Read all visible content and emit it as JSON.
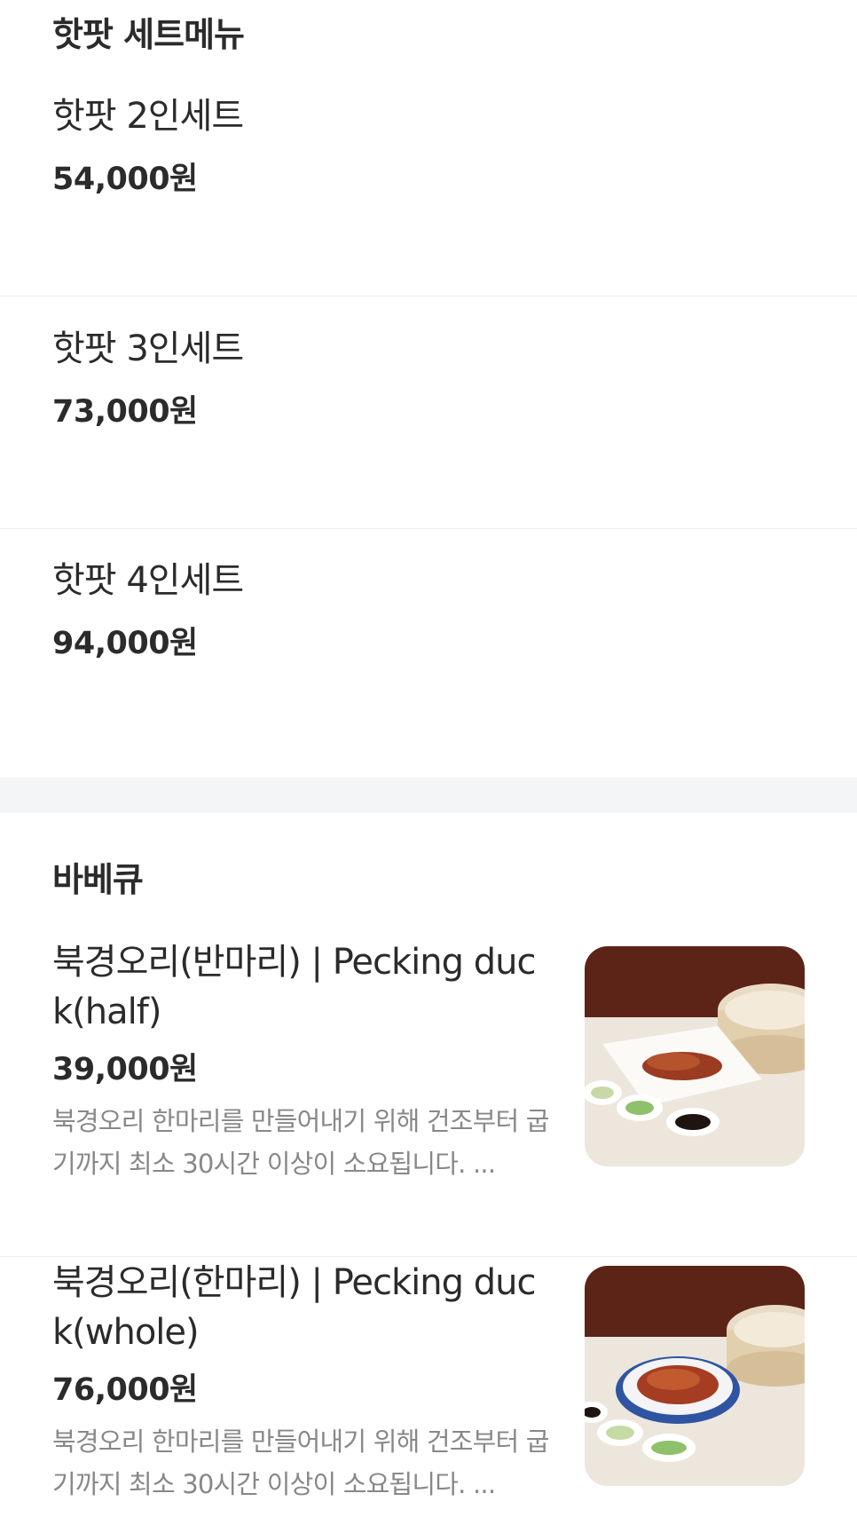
{
  "set_menu": {
    "title": "핫팟 세트메뉴",
    "items": [
      {
        "name": "핫팟 2인세트",
        "price": "54,000원"
      },
      {
        "name": "핫팟 3인세트",
        "price": "73,000원"
      },
      {
        "name": "핫팟 4인세트",
        "price": "94,000원"
      }
    ]
  },
  "bbq": {
    "title": "바베큐",
    "items": [
      {
        "name": "북경오리(반마리) | Pecking duck(half)",
        "price": "39,000원",
        "description": "북경오리 한마리를 만들어내기 위해 건조부터 굽기까지 최소 30시간 이상이 소요됩니다. ..."
      },
      {
        "name": "북경오리(한마리) | Pecking duck(whole)",
        "price": "76,000원",
        "description": "북경오리 한마리를 만들어내기 위해 건조부터 굽기까지 최소 30시간 이상이 소요됩니다. ..."
      }
    ]
  }
}
